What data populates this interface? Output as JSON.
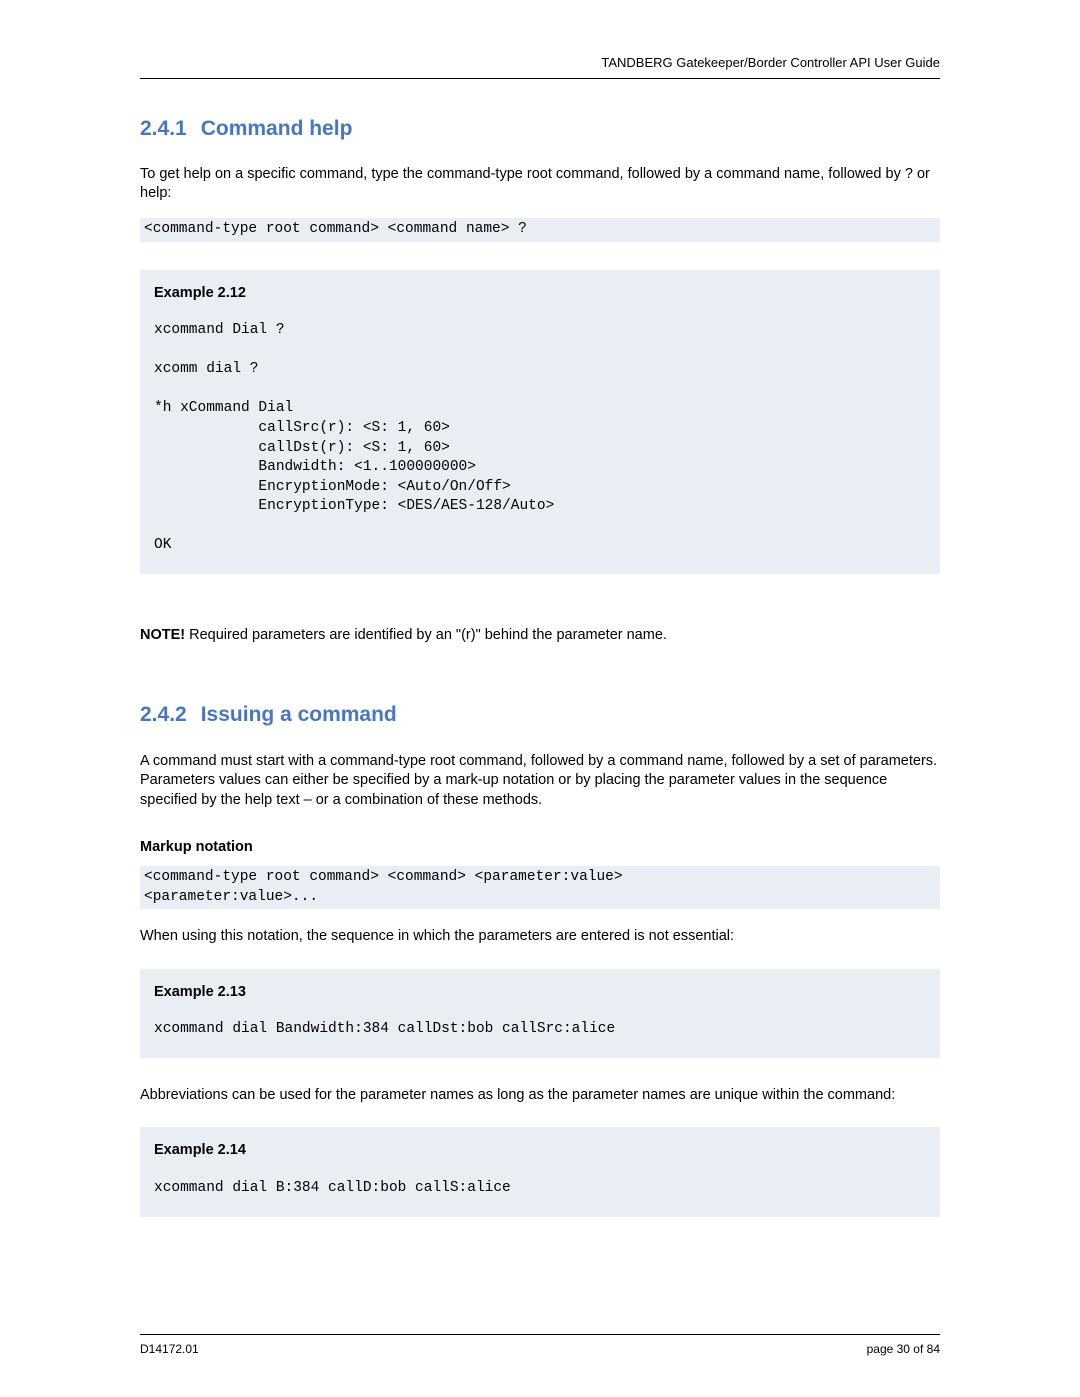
{
  "header": {
    "right": "TANDBERG Gatekeeper/Border Controller API User Guide"
  },
  "section1": {
    "num": "2.4.1",
    "title": "Command help",
    "intro": "To get help on a specific command, type the command-type root command, followed by a command name, followed by ? or help:",
    "codeSliver1": "<command-type root command> <command name> ?",
    "example12": {
      "title": "Example 2.12",
      "code": "xcommand Dial ?\n\nxcomm dial ?\n\n*h xCommand Dial\n            callSrc(r): <S: 1, 60>\n            callDst(r): <S: 1, 60>\n            Bandwidth: <1..100000000>\n            EncryptionMode: <Auto/On/Off>\n            EncryptionType: <DES/AES-128/Auto>\n\nOK"
    },
    "noteLabel": "NOTE!",
    "noteText": " Required parameters are identified by an \"(r)\" behind the parameter name."
  },
  "section2": {
    "num": "2.4.2",
    "title": "Issuing a command",
    "intro": "A command must start with a command-type root command, followed by a command name, followed by a set of parameters. Parameters values can either be specified by a mark-up notation or by placing the parameter values in the sequence specified by the help text – or a combination of these methods.",
    "markupHead": "Markup notation",
    "codeSliver2": "<command-type root command> <command> <parameter:value>\n<parameter:value>...",
    "markupNote": "When using this notation, the sequence in which the parameters are entered is not essential:",
    "example13": {
      "title": "Example 2.13",
      "code": "xcommand dial Bandwidth:384 callDst:bob callSrc:alice"
    },
    "abbrevNote": "Abbreviations can be used for the parameter names as long as the parameter names are unique within the command:",
    "example14": {
      "title": "Example 2.14",
      "code": "xcommand dial B:384 callD:bob callS:alice"
    }
  },
  "footer": {
    "left": "D14172.01",
    "right": "page 30 of 84"
  }
}
